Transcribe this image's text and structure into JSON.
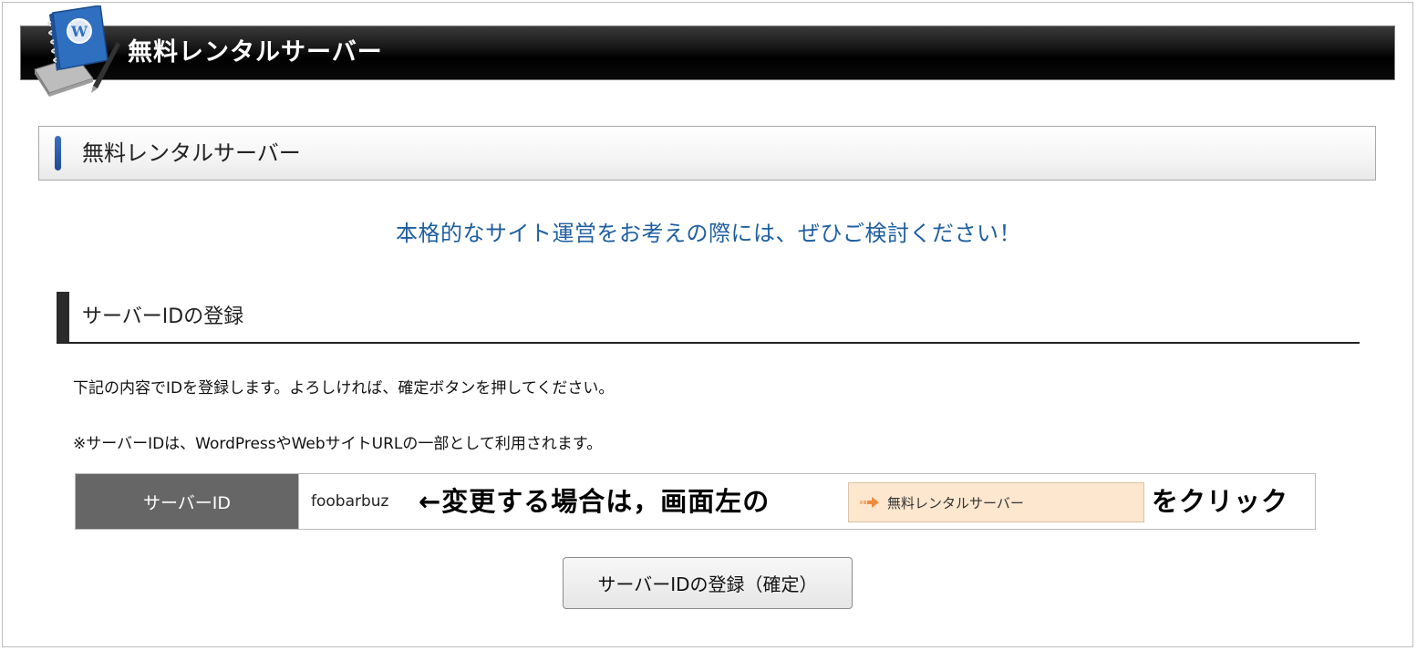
{
  "header": {
    "title": "無料レンタルサーバー",
    "logo_icon": "wordpress-book-icon"
  },
  "section": {
    "title": "無料レンタルサーバー"
  },
  "headline": "本格的なサイト運営をお考えの際には、ぜひご検討ください！",
  "register": {
    "title": "サーバーIDの登録",
    "instruction": "下記の内容でIDを登録します。よろしければ、確定ボタンを押してください。",
    "note": "※サーバーIDは、WordPressやWebサイトURLの一部として利用されます。",
    "table": {
      "label": "サーバーID",
      "value": "foobarbuz",
      "hint_prefix": "←変更する場合は，画面左の",
      "menu_label": "無料レンタルサーバー",
      "menu_icon": "arrow-right-icon",
      "hint_suffix": "をクリック"
    },
    "confirm_button": "サーバーIDの登録（確定）"
  },
  "colors": {
    "headline": "#1f5fa0",
    "label_cell": "#666666",
    "menu_chip": "#fde7cf",
    "accent": "#2f5fb0"
  }
}
